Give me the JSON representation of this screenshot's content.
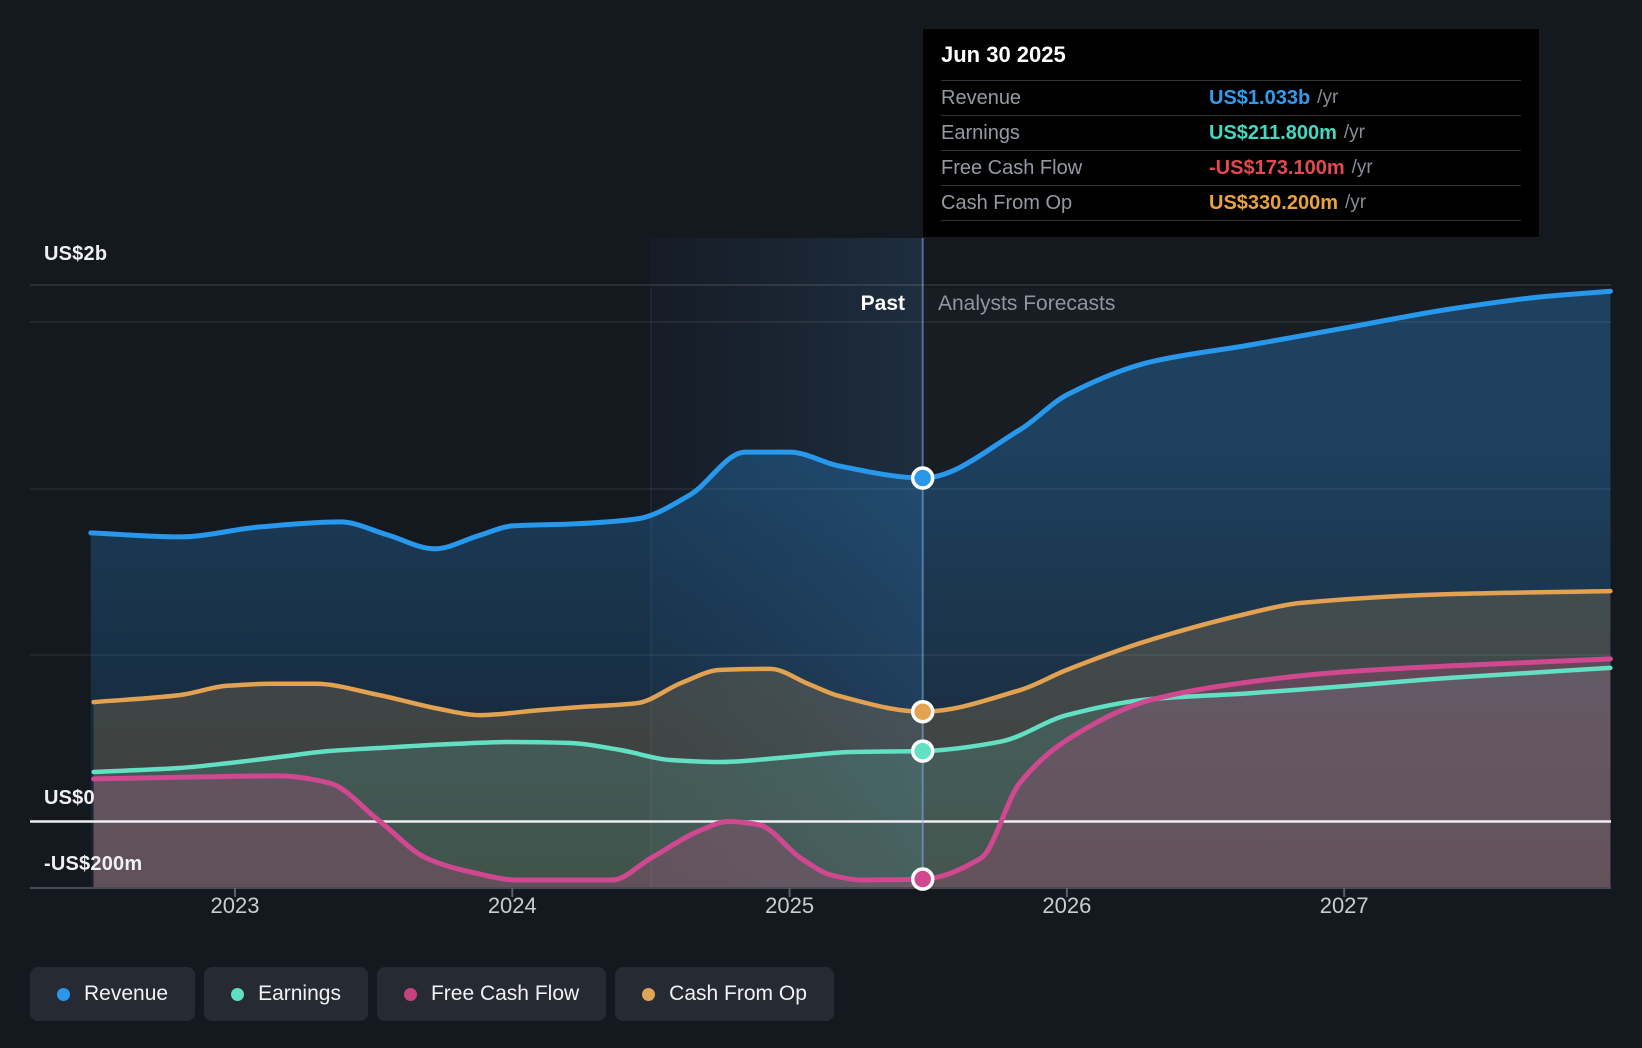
{
  "header": {
    "past_label": "Past",
    "forecast_label": "Analysts Forecasts"
  },
  "axis": {
    "y_top": "US$2b",
    "y_zero": "US$0",
    "y_neg": "-US$200m",
    "x_labels": [
      "2023",
      "2024",
      "2025",
      "2026",
      "2027"
    ]
  },
  "tooltip": {
    "date": "Jun 30 2025",
    "rows": [
      {
        "label": "Revenue",
        "value": "US$1.033b",
        "suffix": "/yr",
        "color": "#2f9cf0"
      },
      {
        "label": "Earnings",
        "value": "US$211.800m",
        "suffix": "/yr",
        "color": "#41d9c1"
      },
      {
        "label": "Free Cash Flow",
        "value": "-US$173.100m",
        "suffix": "/yr",
        "color": "#e5484d"
      },
      {
        "label": "Cash From Op",
        "value": "US$330.200m",
        "suffix": "/yr",
        "color": "#e9a23c"
      }
    ]
  },
  "legend": [
    {
      "label": "Revenue",
      "color": "#2798ec"
    },
    {
      "label": "Earnings",
      "color": "#5fe0c3"
    },
    {
      "label": "Free Cash Flow",
      "color": "#c8417f"
    },
    {
      "label": "Cash From Op",
      "color": "#dfa557"
    }
  ],
  "chart_data": {
    "type": "area",
    "unit": "US$ millions per year",
    "x_domain_years": [
      2022.48,
      2027.96
    ],
    "x_ticks": [
      2023,
      2024,
      2025,
      2026,
      2027
    ],
    "y_axis_labels": [
      "US$2b",
      "US$0",
      "-US$200m"
    ],
    "y_gridline_values_musd": [
      1500,
      1000,
      500,
      0,
      -200
    ],
    "divider_year": 2025.5,
    "divider_label": "Jun 30 2025",
    "past_region_end_year": 2025.5,
    "highlight_band_years": [
      2024.5,
      2025.5
    ],
    "legend_position": "bottom-left",
    "series": [
      {
        "name": "Revenue",
        "color": "#2798ec",
        "marker_value_at_divider": 1033,
        "points": [
          [
            2022.48,
            868
          ],
          [
            2022.8,
            856
          ],
          [
            2023.09,
            886
          ],
          [
            2023.38,
            901
          ],
          [
            2023.55,
            862
          ],
          [
            2023.72,
            820
          ],
          [
            2023.88,
            860
          ],
          [
            2024.0,
            889
          ],
          [
            2024.22,
            895
          ],
          [
            2024.45,
            910
          ],
          [
            2024.64,
            982
          ],
          [
            2024.84,
            1111
          ],
          [
            2025.0,
            1111
          ],
          [
            2025.18,
            1069
          ],
          [
            2025.48,
            1033
          ],
          [
            2025.83,
            1178
          ],
          [
            2026.0,
            1283
          ],
          [
            2026.3,
            1382
          ],
          [
            2026.66,
            1433
          ],
          [
            2027.0,
            1484
          ],
          [
            2027.38,
            1541
          ],
          [
            2027.7,
            1577
          ],
          [
            2027.96,
            1595
          ]
        ]
      },
      {
        "name": "Cash From Op",
        "color": "#e2a251",
        "marker_value_at_divider": 330.2,
        "points": [
          [
            2022.49,
            359
          ],
          [
            2022.8,
            380
          ],
          [
            2022.97,
            408
          ],
          [
            2023.13,
            414
          ],
          [
            2023.29,
            414
          ],
          [
            2023.52,
            380
          ],
          [
            2023.74,
            338
          ],
          [
            2023.88,
            320
          ],
          [
            2024.1,
            335
          ],
          [
            2024.24,
            344
          ],
          [
            2024.45,
            356
          ],
          [
            2024.61,
            417
          ],
          [
            2024.75,
            456
          ],
          [
            2024.93,
            459
          ],
          [
            2025.07,
            413
          ],
          [
            2025.18,
            377
          ],
          [
            2025.48,
            330.2
          ],
          [
            2025.83,
            395
          ],
          [
            2026.0,
            456
          ],
          [
            2026.3,
            546
          ],
          [
            2026.66,
            627
          ],
          [
            2026.84,
            657
          ],
          [
            2027.38,
            684
          ],
          [
            2027.96,
            693
          ]
        ]
      },
      {
        "name": "Earnings",
        "color": "#63dfc3",
        "marker_value_at_divider": 211.8,
        "points": [
          [
            2022.49,
            149
          ],
          [
            2022.8,
            161
          ],
          [
            2022.98,
            176
          ],
          [
            2023.16,
            194
          ],
          [
            2023.34,
            212
          ],
          [
            2023.52,
            221
          ],
          [
            2023.78,
            233
          ],
          [
            2024.0,
            239
          ],
          [
            2024.21,
            236
          ],
          [
            2024.39,
            215
          ],
          [
            2024.57,
            185
          ],
          [
            2024.75,
            179
          ],
          [
            2025.0,
            194
          ],
          [
            2025.22,
            209
          ],
          [
            2025.48,
            211.8
          ],
          [
            2025.76,
            240
          ],
          [
            2026.0,
            320
          ],
          [
            2026.3,
            368
          ],
          [
            2026.66,
            386
          ],
          [
            2027.0,
            407
          ],
          [
            2027.38,
            432
          ],
          [
            2027.96,
            462
          ]
        ]
      },
      {
        "name": "Free Cash Flow",
        "color": "#cf4890",
        "marker_value_at_divider": -173.1,
        "points": [
          [
            2022.49,
            128
          ],
          [
            2022.87,
            134
          ],
          [
            2023.16,
            137
          ],
          [
            2023.34,
            116
          ],
          [
            2023.52,
            2
          ],
          [
            2023.69,
            -110
          ],
          [
            2023.85,
            -152
          ],
          [
            2024.02,
            -176
          ],
          [
            2024.36,
            -176
          ],
          [
            2024.5,
            -110
          ],
          [
            2024.68,
            -26
          ],
          [
            2024.78,
            0
          ],
          [
            2024.89,
            -10
          ],
          [
            2025.04,
            -110
          ],
          [
            2025.15,
            -161
          ],
          [
            2025.26,
            -176
          ],
          [
            2025.48,
            -173.1
          ],
          [
            2025.69,
            -110
          ],
          [
            2025.83,
            116
          ],
          [
            2026.0,
            245
          ],
          [
            2026.3,
            365
          ],
          [
            2026.66,
            420
          ],
          [
            2027.0,
            450
          ],
          [
            2027.38,
            468
          ],
          [
            2027.96,
            489
          ]
        ]
      }
    ]
  }
}
